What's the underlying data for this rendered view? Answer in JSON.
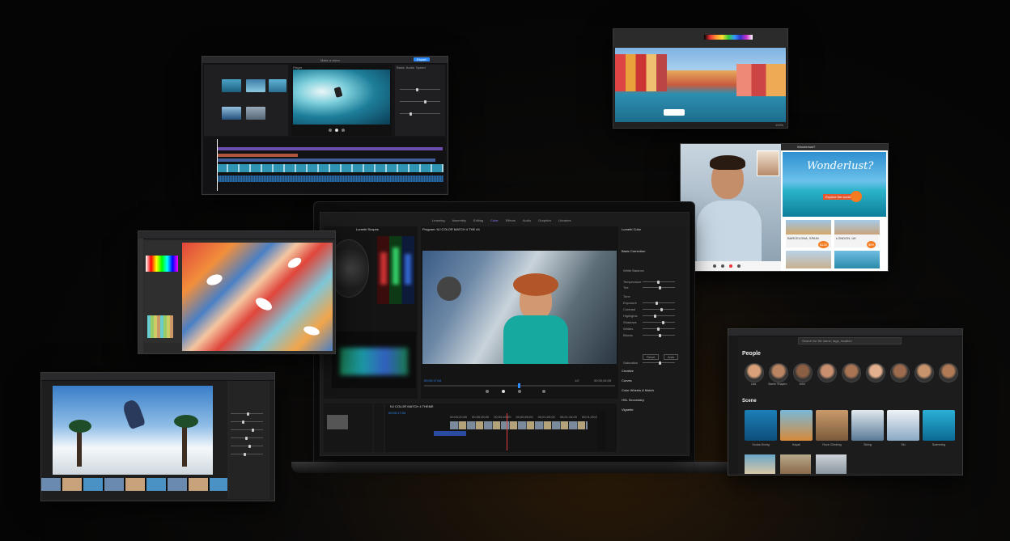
{
  "video_editor": {
    "title": "Make a video",
    "player_label": "Player",
    "export_button": "Export",
    "tabs": [
      "Basic",
      "Audio",
      "Speed",
      "Animation",
      "Adjust"
    ]
  },
  "paint_window": {
    "status": "100%"
  },
  "video_call": {
    "browser_title": "Wonderlust?",
    "headline": "Wonderlust?",
    "tag": "Explore the world",
    "cards": [
      {
        "title": "BARCELONA, SPAIN",
        "price": "$120"
      },
      {
        "title": "LONDON, UK",
        "price": "$99"
      }
    ]
  },
  "premiere": {
    "workspaces": [
      "Learning",
      "Assembly",
      "Editing",
      "Color",
      "Effects",
      "Audio",
      "Graphics",
      "Libraries"
    ],
    "active_workspace": "Color",
    "program_label": "Program: NJ COLOR MATCH 4 THE #4",
    "timecode_left": "00;00;17;04",
    "timecode_right": "00;00;34;05",
    "fit_label": "1/2",
    "timeline_timecode": "00;00;17;04",
    "timeline_tab": "NJ COLOR MATCH 4 THEME",
    "lumetri_title": "Lumetri Color",
    "lumetri_sections": [
      "Basic Correction",
      "Creative",
      "Curves",
      "Color Wheels & Match",
      "HSL Secondary",
      "Vignette"
    ],
    "lumetri_params": [
      "White Balance",
      "Temperature",
      "Tint",
      "Tone",
      "Exposure",
      "Contrast",
      "Highlights",
      "Shadows",
      "Whites",
      "Blacks",
      "Saturation"
    ],
    "lumetri_buttons": [
      "Reset",
      "Auto"
    ],
    "scopes_tab": "Lumetri Scopes",
    "ruler": [
      "00;00;20;00",
      "00;00;30;00",
      "00;00;40;00",
      "00;00;50;00",
      "00;01;00;00",
      "00;01;10;00",
      "00;01;20;00"
    ]
  },
  "gallery": {
    "search_placeholder": "Search for file name, tags, location",
    "people_heading": "People",
    "people": [
      "Liza",
      "Barrie Shapiro",
      "John",
      "",
      "",
      "",
      "",
      "",
      ""
    ],
    "scene_heading": "Scene",
    "scenes": [
      "Scuba Diving",
      "Kayak",
      "Rock Climbing",
      "Skiing",
      "Ski",
      "Swimming"
    ]
  },
  "colors": {
    "accent_blue": "#2d8cff",
    "premiere_purple": "#8a7cff",
    "timeline_red": "#e04040"
  }
}
